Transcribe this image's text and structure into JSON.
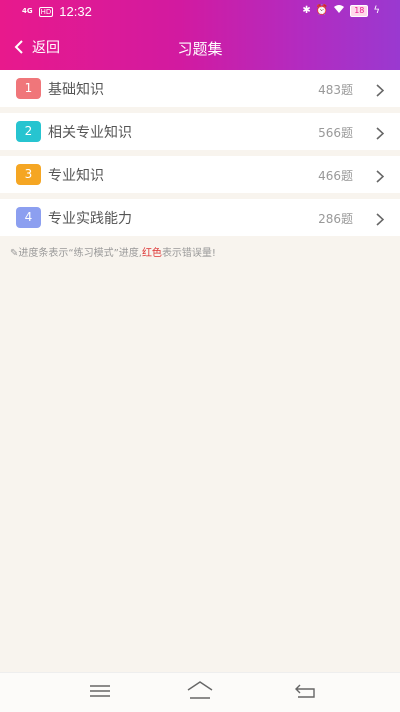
{
  "status_bar": {
    "network": "4G",
    "hd": "HD",
    "time": "12:32",
    "battery": "18"
  },
  "header": {
    "back_label": "返回",
    "title": "习题集"
  },
  "items": [
    {
      "index": "1",
      "label": "基础知识",
      "count": "483题",
      "color": "#f0767a"
    },
    {
      "index": "2",
      "label": "相关专业知识",
      "count": "566题",
      "color": "#27c4d0"
    },
    {
      "index": "3",
      "label": "专业知识",
      "count": "466题",
      "color": "#f5a623"
    },
    {
      "index": "4",
      "label": "专业实践能力",
      "count": "286题",
      "color": "#8c9ff0"
    }
  ],
  "hint": {
    "prefix": "进度条表示“练习模式”进度,",
    "red_word": "红色",
    "suffix": "表示错误量!"
  }
}
